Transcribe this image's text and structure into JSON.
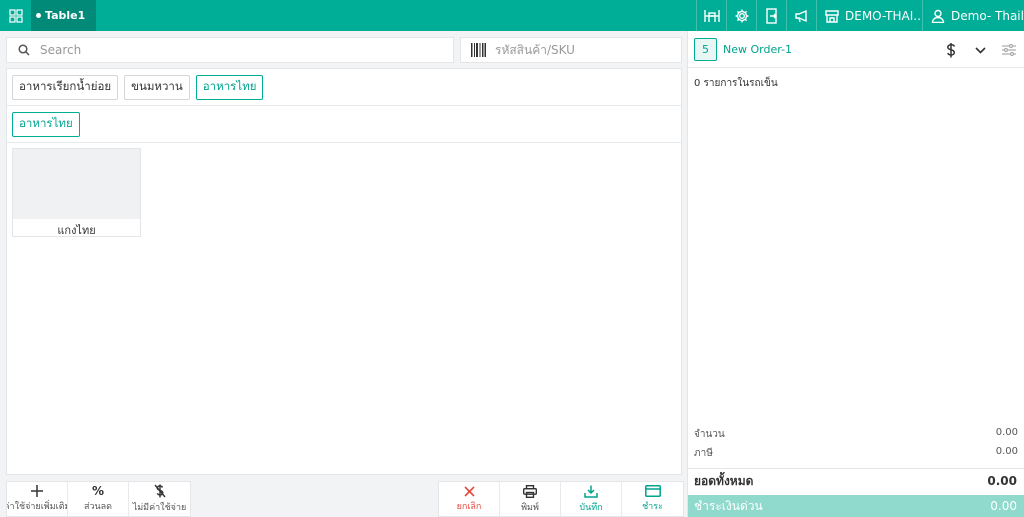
{
  "topbar": {
    "table_tab": "Table1",
    "store_name": "DEMO-THAI...",
    "user_name": "Demo- Thail..."
  },
  "search": {
    "placeholder": "Search"
  },
  "sku": {
    "placeholder": "รหัสสินค้า/SKU"
  },
  "categories": [
    {
      "label": "อาหารเรียกน้ำย่อย"
    },
    {
      "label": "ขนมหวาน"
    },
    {
      "label": "อาหารไทย"
    }
  ],
  "subcategories": [
    {
      "label": "อาหารไทย"
    }
  ],
  "products": [
    {
      "name": "แกงไทย"
    }
  ],
  "actions_left": [
    {
      "label": "ค่าใช้จ่ายเพิ่มเติม",
      "icon": "plus-icon"
    },
    {
      "label": "ส่วนลด",
      "icon": "percent-icon"
    },
    {
      "label": "ไม่มีค่าใช้จ่าย",
      "icon": "no-dollar-icon"
    }
  ],
  "actions_right": [
    {
      "label": "ยกเลิก",
      "icon": "close-icon"
    },
    {
      "label": "พิมพ์",
      "icon": "printer-icon"
    },
    {
      "label": "บันทึก",
      "icon": "download-icon"
    },
    {
      "label": "ชำระ",
      "icon": "card-icon"
    }
  ],
  "order": {
    "number": "5",
    "name": "New Order-1",
    "items_text": "0 รายการในรถเข็น",
    "quantity_label": "จำนวน",
    "quantity_value": "0.00",
    "tax_label": "ภาษี",
    "tax_value": "0.00",
    "total_label": "ยอดทั้งหมด",
    "total_value": "0.00",
    "quick_pay_label": "ชำระเงินด่วน",
    "quick_pay_value": "0.00"
  },
  "colors": {
    "accent": "#00ad96",
    "accent_dark": "#008a77",
    "cancel": "#e5483f",
    "quick_pay": "#8fd9cd"
  }
}
